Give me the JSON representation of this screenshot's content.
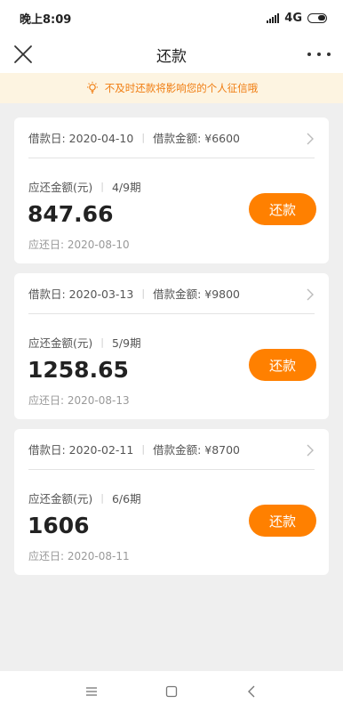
{
  "status_bar": {
    "time": "晚上8:09",
    "network": "4G"
  },
  "nav": {
    "title": "还款"
  },
  "notice": {
    "text": "不及时还款将影响您的个人征信哦"
  },
  "loans": [
    {
      "loan_date_label": "借款日: 2020-04-10",
      "loan_amount_label": "借款金额: ¥6600",
      "due_amount_label": "应还金额(元)",
      "period": "4/9期",
      "amount": "847.66",
      "due_date_label": "应还日: 2020-08-10",
      "button_label": "还款"
    },
    {
      "loan_date_label": "借款日: 2020-03-13",
      "loan_amount_label": "借款金额: ¥9800",
      "due_amount_label": "应还金额(元)",
      "period": "5/9期",
      "amount": "1258.65",
      "due_date_label": "应还日: 2020-08-13",
      "button_label": "还款"
    },
    {
      "loan_date_label": "借款日: 2020-02-11",
      "loan_amount_label": "借款金额: ¥8700",
      "due_amount_label": "应还金额(元)",
      "period": "6/6期",
      "amount": "1606",
      "due_date_label": "应还日: 2020-08-11",
      "button_label": "还款"
    }
  ],
  "colors": {
    "accent": "#ff8000",
    "notice_bg": "#fdf4e1",
    "notice_text": "#f07d11"
  },
  "icons": [
    "close-icon",
    "more-icon",
    "lightbulb-icon",
    "chevron-right-icon",
    "menu-icon",
    "home-icon",
    "back-icon"
  ]
}
